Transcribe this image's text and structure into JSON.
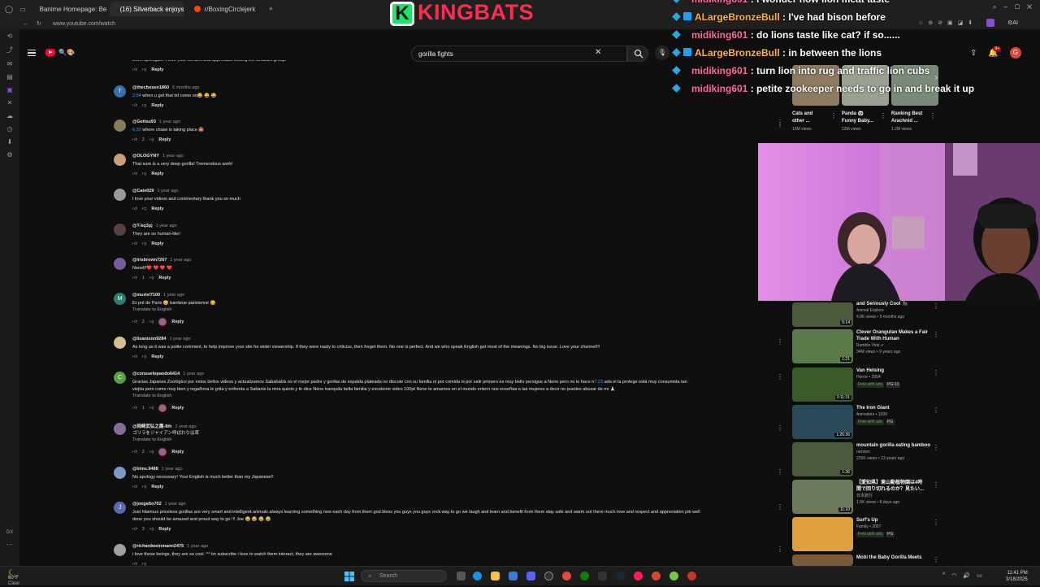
{
  "browser": {
    "tabs": [
      {
        "label": "Banime Homepage: Best ...",
        "active": false,
        "color": "#7b3fe4"
      },
      {
        "label": "(16) Silverback enjoys be...",
        "active": true,
        "color": "#ff0033"
      },
      {
        "label": "r/BoxingCirclejerk",
        "active": false,
        "color": "#ff4500"
      }
    ],
    "url": "www.youtube.com/watch"
  },
  "youtube": {
    "search_query": "gorilla fights",
    "notification_count": "9+",
    "user_initial": "G"
  },
  "overlay": {
    "logo_letter": "K",
    "logo_text": "KINGBATS",
    "chat": [
      {
        "user": "midiking601",
        "message": "i wonder how lion meat taste",
        "color": "#ff6b9d"
      },
      {
        "user": "ALargeBronzeBull",
        "message": "I've had bison before",
        "color": "#ffb347"
      },
      {
        "user": "midiking601",
        "message": "do lions taste like cat? if so......",
        "color": "#ff6b9d"
      },
      {
        "user": "ALargeBronzeBull",
        "message": "in between the lions",
        "color": "#ffb347"
      },
      {
        "user": "midiking601",
        "message": "turn lion into rug and traffic lion cubs",
        "color": "#ff6b9d"
      },
      {
        "user": "midiking601",
        "message": "petite zookeeper needs to go in and break it up",
        "color": "#ff6b9d"
      }
    ]
  },
  "comments": [
    {
      "handle": "",
      "time": "",
      "text": "Don't apologize. I love your content and appreciate seeing the Shabani group.",
      "likes": "",
      "reply": "Reply",
      "avatar_color": "#555",
      "avatar_letter": ""
    },
    {
      "handle": "@thechosen1860",
      "time": "5 months ago",
      "ts": "2:54",
      "text": " when u get that txt come on😂 😂 😂",
      "likes": "",
      "reply": "Reply",
      "avatar_color": "#3a6ea5",
      "avatar_letter": "T"
    },
    {
      "handle": "@Gettsu93",
      "time": "1 year ago",
      "ts": "6:32",
      "text": " where chase is taking place 🏟️",
      "likes": "2",
      "reply": "Reply",
      "avatar_color": "#8a7a5a",
      "avatar_letter": ""
    },
    {
      "handle": "@OLOGYNY",
      "time": "1 year ago",
      "text": "That sure is a very deep gorilla! Tremendous work!",
      "likes": "",
      "reply": "Reply",
      "avatar_color": "#c8a080",
      "avatar_letter": ""
    },
    {
      "handle": "@Cate029",
      "time": "1 year ago",
      "text": "I love your videos and commentary thank you so much",
      "likes": "",
      "reply": "Reply",
      "avatar_color": "#9a9a9a",
      "avatar_letter": ""
    },
    {
      "handle": "@T-kq3pj",
      "time": "1 year ago",
      "text": "They are so human-like!",
      "likes": "",
      "reply": "Reply",
      "avatar_color": "#5a4040",
      "avatar_letter": ""
    },
    {
      "handle": "@irisbrown7267",
      "time": "1 year ago",
      "text": "Nenell!❤️ ❤️ ❤️ ❤️",
      "likes": "1",
      "reply": "Reply",
      "avatar_color": "#7a5a9a",
      "avatar_letter": ""
    },
    {
      "handle": "@muriel7100",
      "time": "1 year ago",
      "text": "Et pré de Paris 😊 banlieue parisienne 😊",
      "translate": "Translate to English",
      "likes": "2",
      "reply": "Reply",
      "avatar_color": "#2e7d6e",
      "avatar_letter": "M"
    },
    {
      "handle": "@lisanison9284",
      "time": "1 year ago",
      "text": "As long as it was a polite comment, to help improve your site for wider viewership. If they were nasty to criticize, then forget them. No one is perfect. And we who speak English get most of the meanings. No big issue. Love your channel!!!",
      "likes": "",
      "reply": "Reply",
      "avatar_color": "#d4c090",
      "avatar_letter": ""
    },
    {
      "handle": "@consuelopando6414",
      "time": "1 year ago",
      "text": "Gracias Japanes Zoológico por estos bellos videos y actualizamos Sabababis es el mejor padre y gorilas de espalda plateada no discute con su familia ni por comida ni por salir primero es muy bello persigue a Nene pero no le hace n",
      "ts2": "7:23",
      "text_b": " ada el la protege está muy consumida tan",
      "text2": "viejita pero come muy bien y regañona le grita y enfrenta a Sabanis la mira quieto y le dice Nene tranquila bella familia y excelente video 100pt Nene te amamos en el mundo entero nos enseñaa a las mujeres a decir no puedes abusar de mi 🙏🏻",
      "translate": "Translate to English",
      "likes": "1",
      "reply": "Reply",
      "avatar_color": "#5aa04a",
      "avatar_letter": "C"
    },
    {
      "handle": "@岡崎武弘之趣-8th",
      "time": "1 year ago",
      "text": "ゴリラをジャイアン呼ばわりは草",
      "translate": "Translate to English",
      "likes": "2",
      "reply": "Reply",
      "avatar_color": "#8a6a9a",
      "avatar_letter": ""
    },
    {
      "handle": "@kims.9488",
      "time": "1 year ago",
      "text": "No apology necessary!  Your English is much better than my Japanese!!",
      "likes": "",
      "reply": "Reply",
      "avatar_color": "#7a9ac8",
      "avatar_letter": ""
    },
    {
      "handle": "@joegalto702",
      "time": "1 year ago",
      "text": "Just hilarious priceless gorillas are very smart and intelligent animals always learning something new each day from them god bless you guys you guys rock way to go we laugh and learn and benefit from them stay safe and warm out there much love and respect and appreciation job well",
      "text2": "done you should be amazed and proud way to go  !!! Joe 😂 😂 😂 😂",
      "likes": "3",
      "reply": "Reply",
      "avatar_color": "#5a6ab0",
      "avatar_letter": "J"
    },
    {
      "handle": "@richardweinmann2475",
      "time": "1 year ago",
      "text": "i love these beings, they are so cool. ^^ im subscribe i love to watch them interact, they are awesome",
      "likes": "",
      "reply": "",
      "avatar_color": "#a0a0a0",
      "avatar_letter": ""
    }
  ],
  "recommendations_top": [
    {
      "title1": "Cats and",
      "title2": "other ...",
      "views": "13M views",
      "color": "#8d7a60"
    },
    {
      "title1": "Panda 🐼",
      "title2": "Funny Baby...",
      "views": "12M views",
      "color": "#9aa090"
    },
    {
      "title1": "Ranking Best",
      "title2": "Arachnid ...",
      "views": "1.2M views",
      "color": "#7a8a7a"
    }
  ],
  "recommendations": [
    {
      "title1": "and Seriously Cool 🦍",
      "title2": "",
      "channel": "Animal Explore",
      "meta": "4.8K views • 5 months ago",
      "duration": "5:14",
      "color": "#4a5a3a",
      "pills": []
    },
    {
      "title1": "Clever Orangutan Makes a Fair",
      "title2": "Trade With Human",
      "channel": "Rumble Viral ✔",
      "meta": "34M views • 9 years ago",
      "duration": "1:21",
      "color": "#5a7a4a",
      "pills": []
    },
    {
      "title1": "Van Helsing",
      "title2": "",
      "channel": "Horror • 2004",
      "meta": "",
      "duration": "2:11:31",
      "color": "#3a5a2a",
      "pills": [
        "Free with ads",
        "PG-13"
      ]
    },
    {
      "title1": "The Iron Giant",
      "title2": "",
      "channel": "Animation • 1999",
      "meta": "",
      "duration": "1:26:36",
      "color": "#2a4a5a",
      "pills": [
        "Free with ads",
        "PG"
      ]
    },
    {
      "title1": "mountain gorilla eating bamboo",
      "title2": "",
      "channel": "ramiom",
      "meta": "226K views • 13 years ago",
      "duration": "1:36",
      "color": "#4a5a3a",
      "pills": []
    },
    {
      "title1": "【愛知県】東山動植物園は4時",
      "title2": "間で回り切れるのか？見たい...",
      "channel": "日本旅行",
      "meta": "1.5K views • 8 days ago",
      "duration": "11:10",
      "color": "#6a7a5a",
      "pills": []
    },
    {
      "title1": "Surf's Up",
      "title2": "",
      "channel": "Family • 2007",
      "meta": "",
      "duration": "",
      "color": "#e0a040",
      "pills": [
        "Free with ads",
        "PG"
      ]
    },
    {
      "title1": "Mobi the Baby Gorilla Meets",
      "title2": "",
      "channel": "",
      "meta": "",
      "duration": "",
      "color": "#7a5a3a",
      "pills": []
    }
  ],
  "taskbar": {
    "temp": "60°F",
    "weather": "Clear",
    "search_placeholder": "Search",
    "time": "11:41 PM",
    "date": "3/18/2025"
  }
}
